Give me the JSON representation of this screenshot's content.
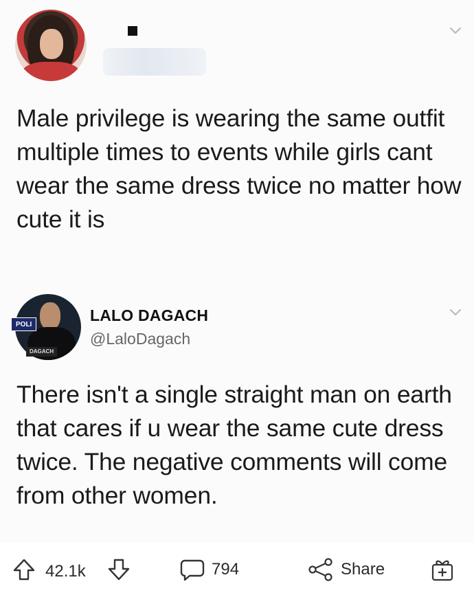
{
  "tweet1": {
    "name_redacted": true,
    "text": "Male privilege is wearing the same outfit multiple times to events while girls cant wear the same dress twice  no matter how cute it is"
  },
  "tweet2": {
    "author_name": "LALO DAGACH",
    "author_handle": "@LaloDagach",
    "avatar_badge_top": "POLI",
    "avatar_badge_bottom": "DAGACH",
    "text": "There isn't a single straight man on earth that cares if u wear the same cute dress twice. The negative comments will come from other women."
  },
  "actions": {
    "upvote_icon": "arrow-up-icon",
    "score": "42.1k",
    "downvote_icon": "arrow-down-icon",
    "comments_icon": "comment-bubble-icon",
    "comments_count": "794",
    "share_icon": "share-icon",
    "share_label": "Share",
    "award_icon": "gift-award-icon"
  },
  "colors": {
    "background": "#fbfbfb",
    "text": "#1a1a1a",
    "handle": "#666666"
  }
}
